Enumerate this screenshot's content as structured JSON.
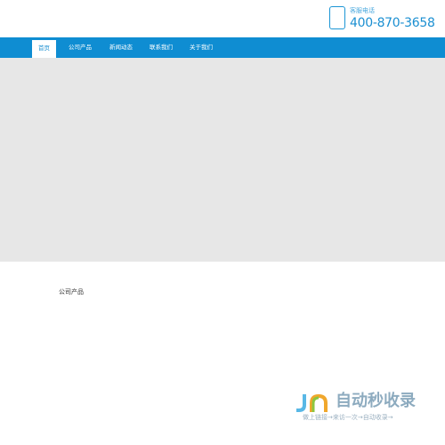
{
  "header": {
    "phone_label": "客服电话",
    "phone_number": "400-870-3658",
    "phone_icon": "phone-icon"
  },
  "nav": {
    "items": [
      {
        "label": "首页",
        "active": true
      },
      {
        "label": "公司产品",
        "active": false
      },
      {
        "label": "新闻动态",
        "active": false
      },
      {
        "label": "联系我们",
        "active": false
      },
      {
        "label": "关于我们",
        "active": false
      }
    ]
  },
  "section": {
    "title": "公司产品"
  },
  "watermark": {
    "title": "自动秒收录",
    "subtitle": "做上链接→来访一次→自动收录→"
  },
  "colors": {
    "nav_bg": "#0f8dd2",
    "banner_bg": "#e7e7e7",
    "accent": "#1b8fd1"
  }
}
